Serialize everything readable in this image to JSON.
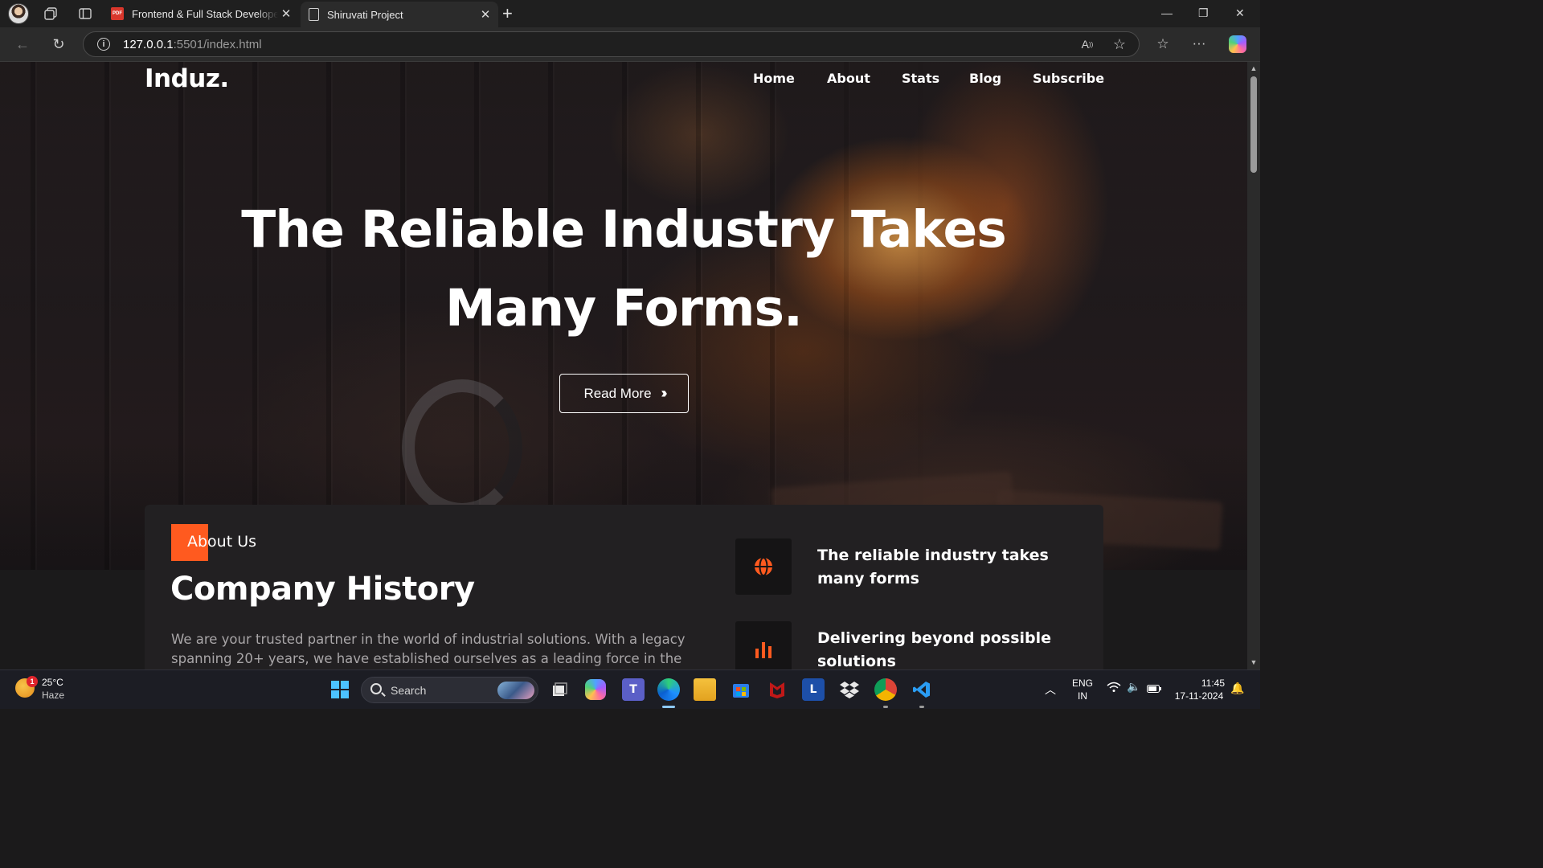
{
  "browser": {
    "tabs": [
      {
        "title": "Frontend & Full Stack Developer I",
        "favicon": "pdf-icon",
        "active": false
      },
      {
        "title": "Shiruvati Project",
        "favicon": "page-icon",
        "active": true
      }
    ],
    "pdf_favicon_text": "PDF",
    "url_host": "127.0.0.1",
    "url_rest": ":5501/index.html"
  },
  "site": {
    "logo": "Induz.",
    "nav": [
      "Home",
      "About",
      "Stats",
      "Blog",
      "Subscribe"
    ],
    "hero": {
      "title_line1": "The Reliable Industry Takes",
      "title_line2": "Many Forms.",
      "button": "Read More"
    },
    "about": {
      "tag": "About Us",
      "heading": "Company History",
      "text": "We are your trusted partner in the world of industrial solutions. With a legacy spanning 20+ years, we have established ourselves as a leading force in the",
      "features": [
        {
          "icon": "globe-icon",
          "title": "The reliable industry takes many forms"
        },
        {
          "icon": "bar-chart-icon",
          "title": "Delivering beyond possible solutions"
        }
      ]
    },
    "accent_color": "#ff5a1f"
  },
  "taskbar": {
    "weather_temp": "25°C",
    "weather_condition": "Haze",
    "weather_badge": "1",
    "search_label": "Search",
    "language_line1": "ENG",
    "language_line2": "IN",
    "time": "11:45",
    "date": "17-11-2024",
    "apps": [
      "windows-start-icon",
      "task-view-icon",
      "copilot-icon",
      "teams-icon",
      "edge-icon",
      "file-explorer-icon",
      "store-icon",
      "mcafee-icon",
      "l-app-icon",
      "dropbox-icon",
      "chrome-icon",
      "vscode-icon"
    ]
  }
}
